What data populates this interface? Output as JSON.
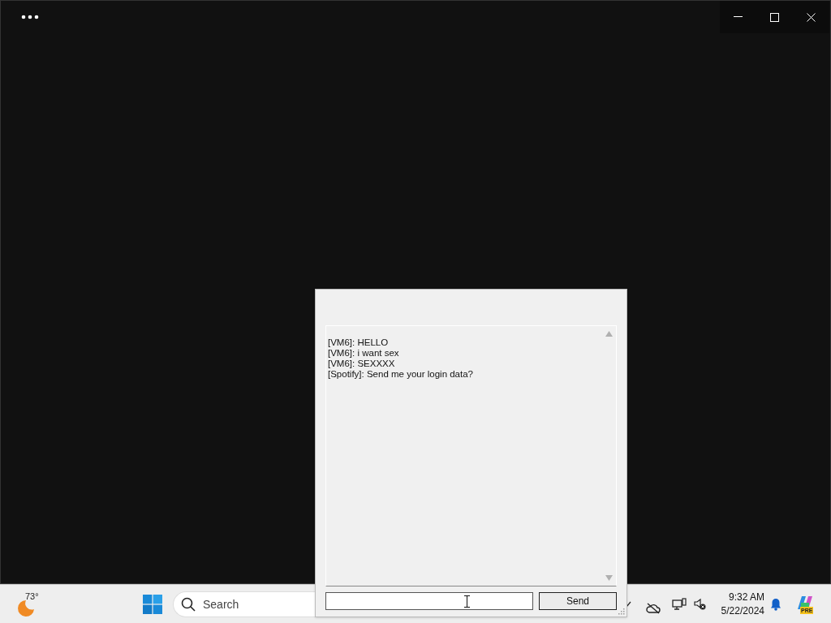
{
  "chat_window": {
    "messages": [
      "[VM6]: HELLO",
      "[VM6]: i want sex",
      "[VM6]: SEXXXX",
      "[Spotify]: Send me your login data?"
    ],
    "send_button": "Send"
  },
  "taskbar": {
    "weather_temp": "73°",
    "search": {
      "placeholder": "Search"
    },
    "time": "9:32 AM",
    "date": "5/22/2024",
    "copilot_badge": "PRE"
  }
}
